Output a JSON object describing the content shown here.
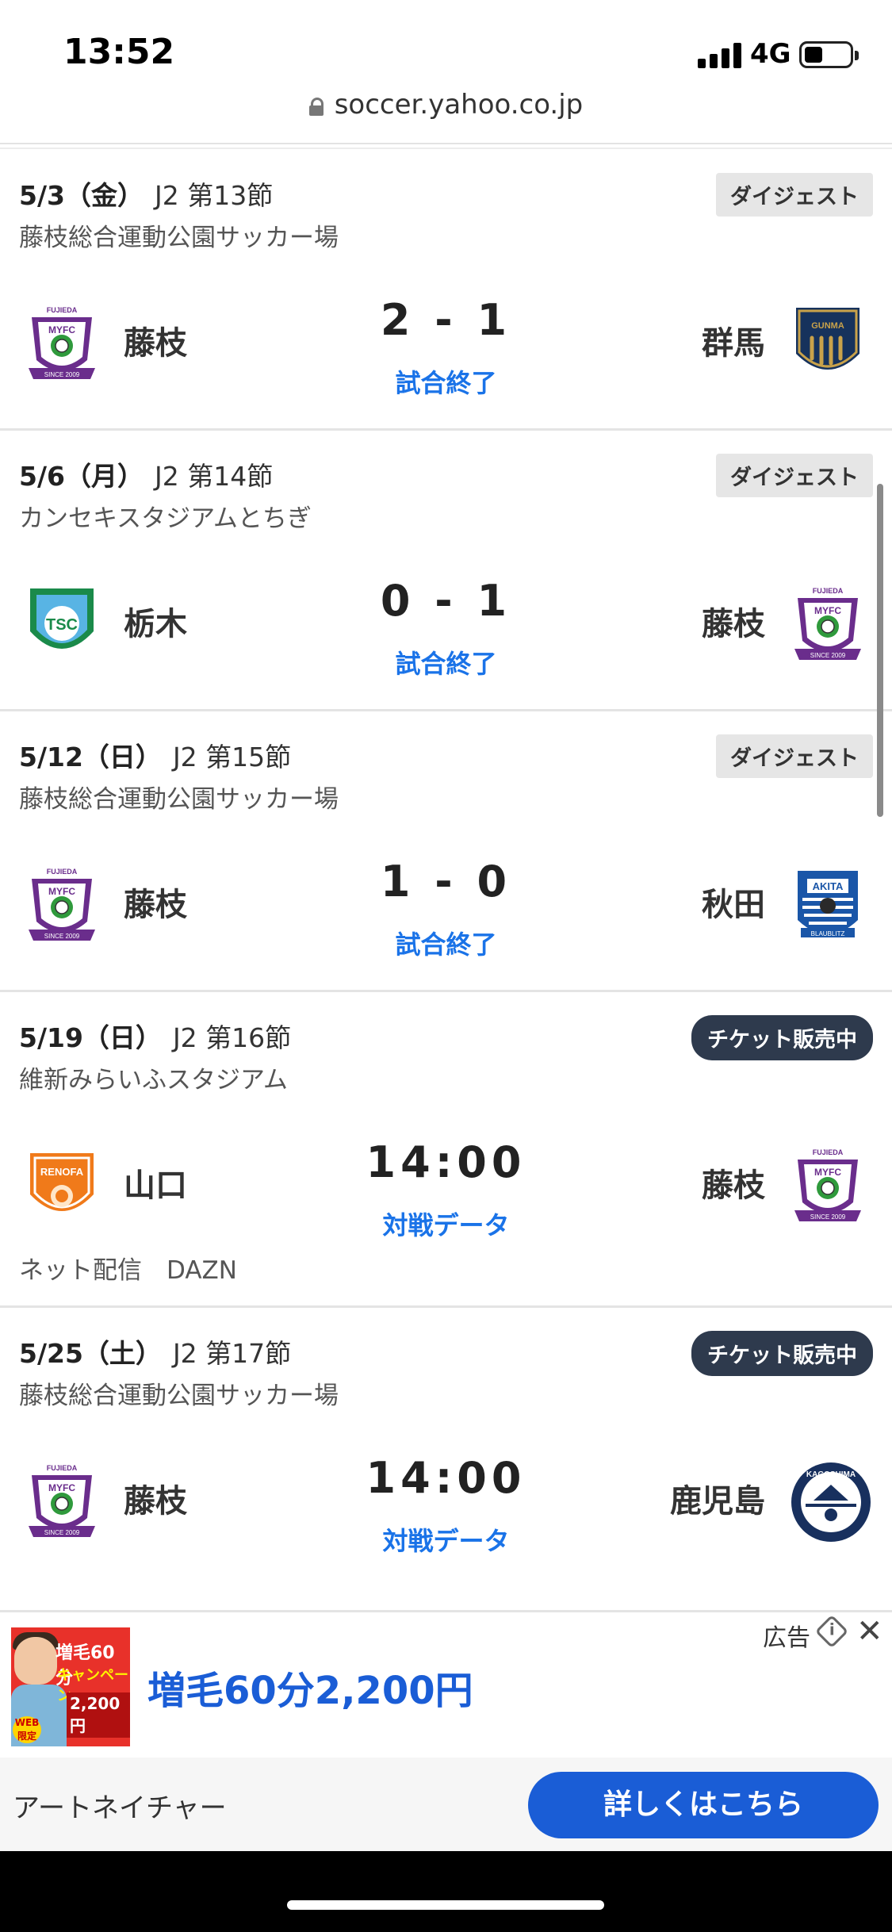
{
  "status_bar": {
    "time": "13:52",
    "network": "4G"
  },
  "browser": {
    "url": "soccer.yahoo.co.jp"
  },
  "matches": [
    {
      "date": "5/3（金）",
      "league": "J2 第13節",
      "venue": "藤枝総合運動公園サッカー場",
      "badge": "ダイジェスト",
      "home": "藤枝",
      "away": "群馬",
      "score": "2 - 1",
      "status": "試合終了",
      "broadcast": ""
    },
    {
      "date": "5/6（月）",
      "league": "J2 第14節",
      "venue": "カンセキスタジアムとちぎ",
      "badge": "ダイジェスト",
      "home": "栃木",
      "away": "藤枝",
      "score": "0 - 1",
      "status": "試合終了",
      "broadcast": ""
    },
    {
      "date": "5/12（日）",
      "league": "J2 第15節",
      "venue": "藤枝総合運動公園サッカー場",
      "badge": "ダイジェスト",
      "home": "藤枝",
      "away": "秋田",
      "score": "1 - 0",
      "status": "試合終了",
      "broadcast": ""
    },
    {
      "date": "5/19（日）",
      "league": "J2 第16節",
      "venue": "維新みらいふスタジアム",
      "badge": "チケット販売中",
      "home": "山口",
      "away": "藤枝",
      "score": "14:00",
      "status": "対戦データ",
      "broadcast": "ネット配信　DAZN"
    },
    {
      "date": "5/25（土）",
      "league": "J2 第17節",
      "venue": "藤枝総合運動公園サッカー場",
      "badge": "チケット販売中",
      "home": "藤枝",
      "away": "鹿児島",
      "score": "14:00",
      "status": "対戦データ",
      "broadcast": ""
    }
  ],
  "crest_labels": {
    "fujieda_top": "FUJIEDA",
    "fujieda_mid": "MYFC",
    "fujieda_bottom": "SINCE 2009",
    "gunma": "GUNMA",
    "tochigi": "TSC",
    "akita_top": "AKITA",
    "akita_bottom": "BLAUBLITZ",
    "yamaguchi": "RENOFA",
    "kagoshima": "KAGOSHIMA"
  },
  "ad": {
    "label": "広告",
    "headline": "増毛60分2,200円",
    "thumb_title": "増毛60分",
    "thumb_sub": "キャンペーン",
    "thumb_price": "2,200円",
    "thumb_web": "WEB限定",
    "advertiser": "アートネイチャー",
    "cta": "詳しくはこちら"
  }
}
